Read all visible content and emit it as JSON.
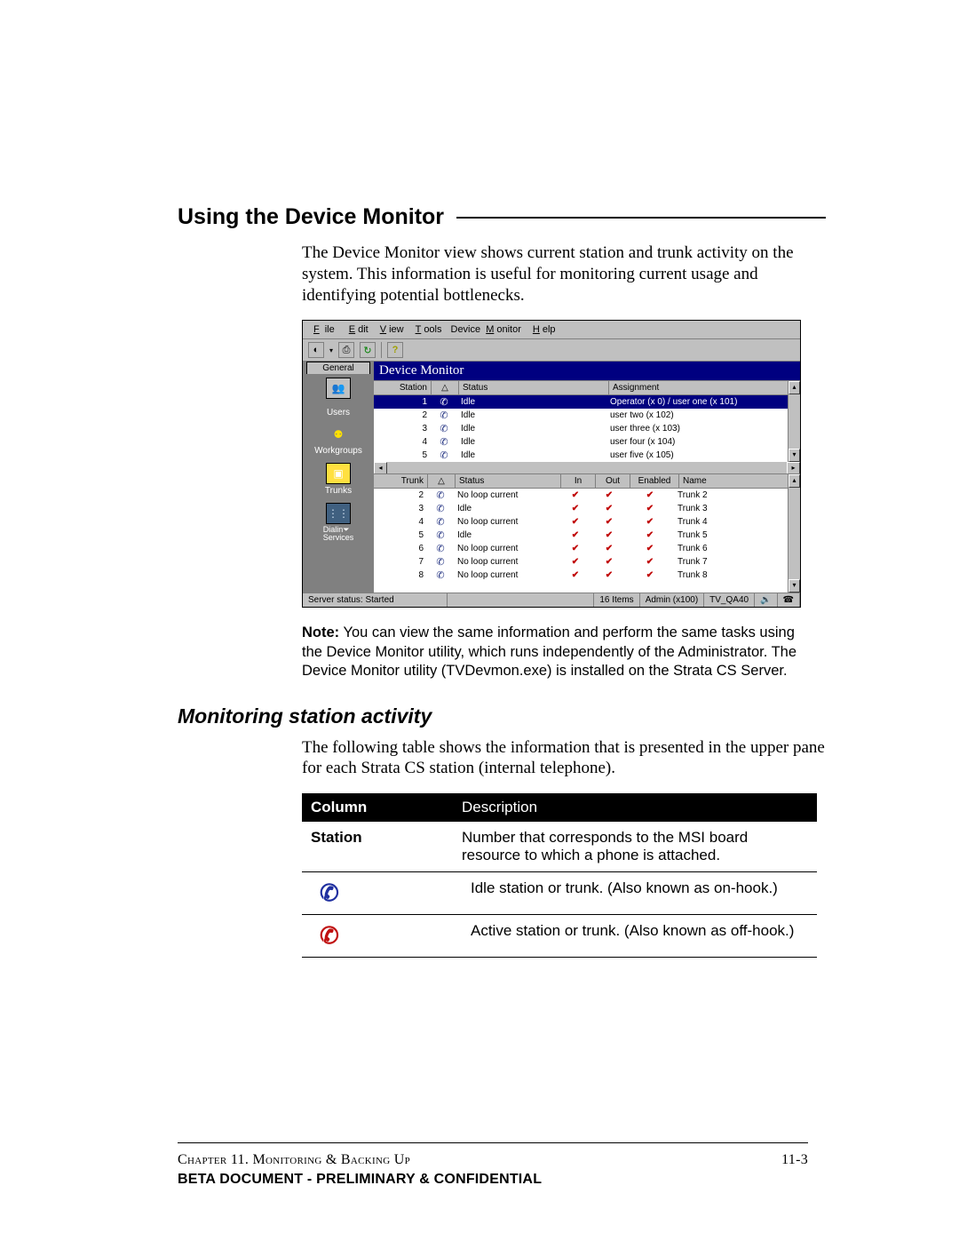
{
  "heading": "Using the Device Monitor",
  "intro": "The Device Monitor view shows current station and trunk activity on the system. This information is useful for monitoring current usage and identifying potential bottlenecks.",
  "screenshot": {
    "menu": [
      "File",
      "Edit",
      "View",
      "Tools",
      "Device Monitor",
      "Help"
    ],
    "tab": "General",
    "sidebar": [
      {
        "label": "",
        "icon": "👥"
      },
      {
        "label": "Users",
        "icon": "👤"
      },
      {
        "label": "Workgroups",
        "icon": "⚉"
      },
      {
        "label": "Trunks",
        "icon": "▣"
      },
      {
        "label": "Dialing Services",
        "icon": "⋮⋮"
      }
    ],
    "title": "Device Monitor",
    "station_head": [
      "Station",
      "",
      "Status",
      "Assignment"
    ],
    "stations": [
      {
        "n": "1",
        "status": "Idle",
        "assign": "Operator (x 0) / user one (x 101)",
        "sel": true
      },
      {
        "n": "2",
        "status": "Idle",
        "assign": "user two (x 102)"
      },
      {
        "n": "3",
        "status": "Idle",
        "assign": "user three (x 103)"
      },
      {
        "n": "4",
        "status": "Idle",
        "assign": "user four (x 104)"
      },
      {
        "n": "5",
        "status": "Idle",
        "assign": "user five (x 105)"
      }
    ],
    "trunk_head": [
      "Trunk",
      "",
      "Status",
      "In",
      "Out",
      "Enabled",
      "Name"
    ],
    "trunks": [
      {
        "n": "2",
        "status": "No loop current",
        "name": "Trunk 2"
      },
      {
        "n": "3",
        "status": "Idle",
        "name": "Trunk 3"
      },
      {
        "n": "4",
        "status": "No loop current",
        "name": "Trunk 4"
      },
      {
        "n": "5",
        "status": "Idle",
        "name": "Trunk 5"
      },
      {
        "n": "6",
        "status": "No loop current",
        "name": "Trunk 6"
      },
      {
        "n": "7",
        "status": "No loop current",
        "name": "Trunk 7"
      },
      {
        "n": "8",
        "status": "No loop current",
        "name": "Trunk 8"
      }
    ],
    "statusbar": {
      "server": "Server status: Started",
      "items": "16 Items",
      "admin": "Admin (x100)",
      "host": "TV_QA40"
    }
  },
  "note_label": "Note:",
  "note": " You can view the same information and perform the same tasks using the Device Monitor utility, which runs independently of the Administrator. The Device Monitor utility (TVDevmon.exe) is installed on the Strata CS Server.",
  "subhead": "Monitoring station activity",
  "subintro": "The following table shows the information that is presented in the upper pane for each Strata CS station (internal telephone).",
  "table": {
    "head": [
      "Column",
      "Description"
    ],
    "rows": [
      {
        "col": "Station",
        "desc": "Number that corresponds to the MSI board resource to which a phone is attached."
      },
      {
        "col": "",
        "icon": "blue",
        "desc": "Idle station or trunk. (Also known as on-hook.)"
      },
      {
        "col": "",
        "icon": "red",
        "desc": "Active station or trunk. (Also known as off-hook.)"
      }
    ]
  },
  "footer": {
    "chapter": "Chapter 11. Monitoring & Backing Up",
    "page": "11-3",
    "conf": "BETA DOCUMENT - PRELIMINARY & CONFIDENTIAL"
  }
}
